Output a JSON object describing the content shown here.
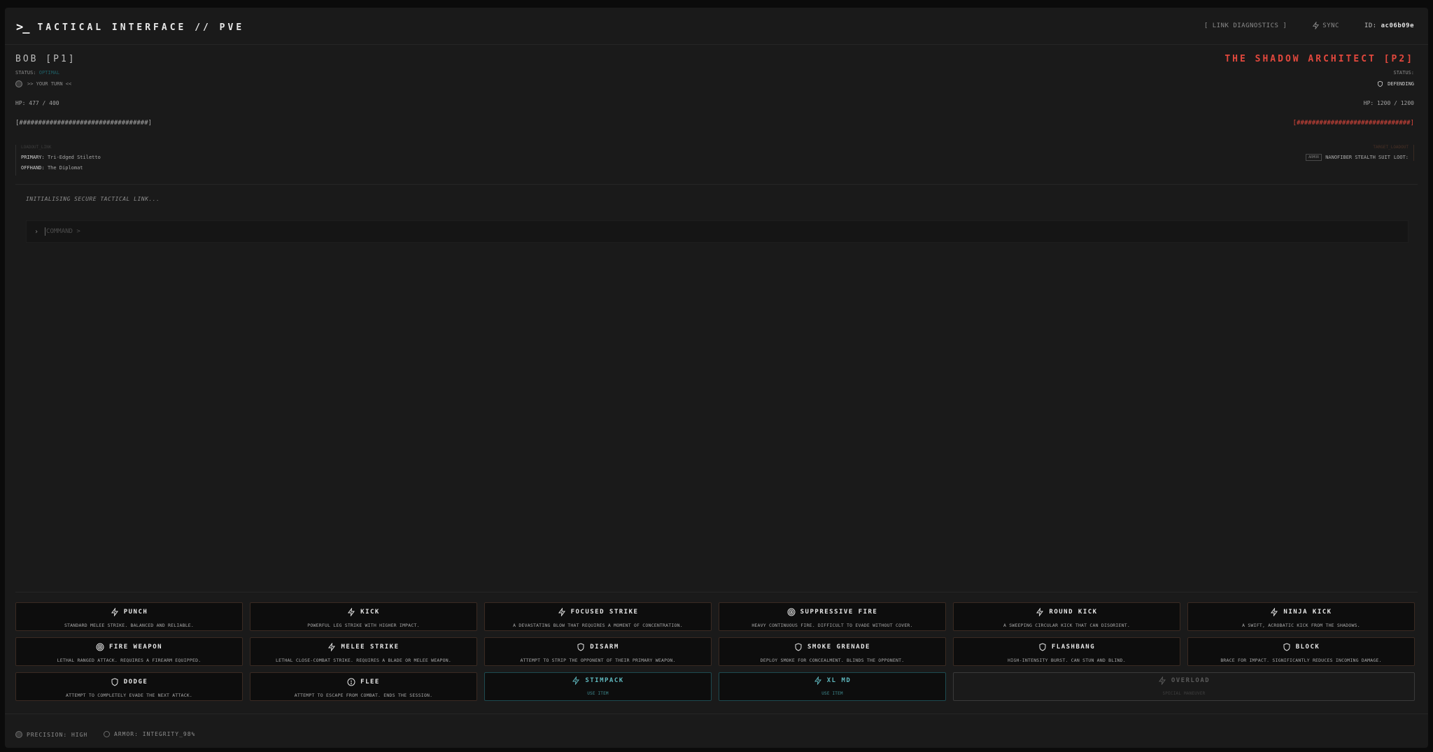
{
  "header": {
    "prompt_glyph": ">_",
    "title": "TACTICAL INTERFACE // PVE",
    "link_diagnostics": "[ LINK DIAGNOSTICS ]",
    "sync_label": "SYNC",
    "id_label": "ID:",
    "id_value": "ac06b09e"
  },
  "player": {
    "name": "BOB [P1]",
    "status_label": "STATUS:",
    "status_value": "OPTIMAL",
    "turn_text": ">> YOUR TURN <<",
    "hp_text": "HP: 477 / 400",
    "hp_bar": "[##################################]",
    "loadout_header": "LOADOUT_LINK",
    "primary_label": "PRIMARY:",
    "primary_value": "Tri-Edged Stiletto",
    "offhand_label": "OFFHAND:",
    "offhand_value": "The Diplomat"
  },
  "enemy": {
    "name": "THE SHADOW ARCHITECT [P2]",
    "status_label": "STATUS:",
    "state_text": "DEFENDING",
    "hp_text": "HP: 1200 / 1200",
    "hp_bar": "[##############################]",
    "loadout_header": "TARGET_LOADOUT",
    "armor_tag": "ARMOR",
    "armor_value": "NANOFIBER STEALTH SUIT",
    "loot_label": "LOOT:"
  },
  "log": {
    "lines": [
      "INITIALISING SECURE TACTICAL LINK..."
    ]
  },
  "command": {
    "placeholder": "COMMAND >"
  },
  "actions": [
    {
      "name": "PUNCH",
      "desc": "STANDARD MELEE STRIKE. BALANCED AND RELIABLE.",
      "icon": "bolt-icon"
    },
    {
      "name": "KICK",
      "desc": "POWERFUL LEG STRIKE WITH HIGHER IMPACT.",
      "icon": "bolt-icon"
    },
    {
      "name": "FOCUSED STRIKE",
      "desc": "A DEVASTATING BLOW THAT REQUIRES A MOMENT OF CONCENTRATION.",
      "icon": "bolt-icon"
    },
    {
      "name": "SUPPRESSIVE FIRE",
      "desc": "HEAVY CONTINUOUS FIRE. DIFFICULT TO EVADE WITHOUT COVER.",
      "icon": "target-icon"
    },
    {
      "name": "ROUND KICK",
      "desc": "A SWEEPING CIRCULAR KICK THAT CAN DISORIENT.",
      "icon": "bolt-icon"
    },
    {
      "name": "NINJA KICK",
      "desc": "A SWIFT, ACROBATIC KICK FROM THE SHADOWS.",
      "icon": "bolt-icon"
    },
    {
      "name": "FIRE WEAPON",
      "desc": "LETHAL RANGED ATTACK. REQUIRES A FIREARM EQUIPPED.",
      "icon": "target-icon"
    },
    {
      "name": "MELEE STRIKE",
      "desc": "LETHAL CLOSE-COMBAT STRIKE. REQUIRES A BLADE OR MELEE WEAPON.",
      "icon": "bolt-icon"
    },
    {
      "name": "DISARM",
      "desc": "ATTEMPT TO STRIP THE OPPONENT OF THEIR PRIMARY WEAPON.",
      "icon": "shield-icon"
    },
    {
      "name": "SMOKE GRENADE",
      "desc": "DEPLOY SMOKE FOR CONCEALMENT. BLINDS THE OPPONENT.",
      "icon": "shield-icon"
    },
    {
      "name": "FLASHBANG",
      "desc": "HIGH-INTENSITY BURST. CAN STUN AND BLIND.",
      "icon": "shield-icon"
    },
    {
      "name": "BLOCK",
      "desc": "BRACE FOR IMPACT. SIGNIFICANTLY REDUCES INCOMING DAMAGE.",
      "icon": "shield-icon"
    },
    {
      "name": "DODGE",
      "desc": "ATTEMPT TO COMPLETELY EVADE THE NEXT ATTACK.",
      "icon": "shield-icon"
    },
    {
      "name": "FLEE",
      "desc": "ATTEMPT TO ESCAPE FROM COMBAT. ENDS THE SESSION.",
      "icon": "alert-icon"
    }
  ],
  "items": [
    {
      "name": "STIMPACK",
      "desc": "USE ITEM",
      "icon": "bolt-icon"
    },
    {
      "name": "XL MD",
      "desc": "USE ITEM",
      "icon": "bolt-icon"
    }
  ],
  "special": {
    "name": "OVERLOAD",
    "desc": "SPECIAL MANEUVER",
    "icon": "bolt-icon"
  },
  "footer": {
    "precision": "PRECISION: HIGH",
    "armor": "ARMOR: INTEGRITY_98%"
  },
  "colors": {
    "accent_enemy": "#e2483d",
    "accent_item": "#5fb8be",
    "background": "#1a1a1a",
    "button_border": "#3a2a22"
  }
}
